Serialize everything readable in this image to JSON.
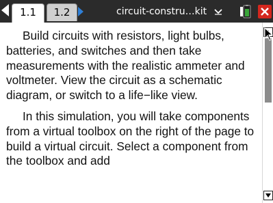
{
  "tabbar": {
    "tabs": [
      {
        "label": "1.1",
        "active": true
      },
      {
        "label": "1.2",
        "active": false
      }
    ],
    "document_title": "circuit-constru…kit",
    "icons": {
      "nav_left": "left-arrow-icon",
      "nav_right": "right-arrow-icon",
      "title_dropdown": "chevron-down-icon",
      "battery": "battery-icon",
      "close": "close-icon"
    }
  },
  "content": {
    "paragraphs": [
      "Build circuits with resistors, light bulbs, batteries, and switches and then take measurements with the realistic ammeter and voltmeter. View the circuit as a schematic diagram, or switch to a life−like view.",
      "In this simulation, you will take components from a virtual toolbox on the right of the page to build a virtual circuit. Select a component from the toolbox and add"
    ]
  },
  "scrollbar": {
    "icons": {
      "up": "scroll-up-arrow-icon",
      "down": "scroll-down-arrow-icon"
    }
  },
  "colors": {
    "tabbar_bg": "#2b2b2b",
    "nav_arrow_accent": "#2f7fd6",
    "close_red": "#d4271e",
    "battery_green": "#3aa63a",
    "scroll_thumb": "#8c8c8c"
  }
}
